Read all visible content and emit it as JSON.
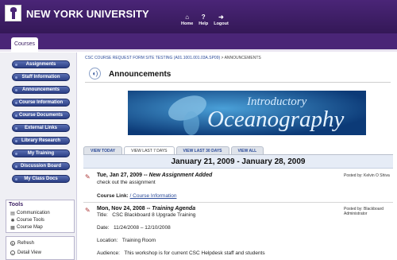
{
  "header": {
    "university": "NEW YORK UNIVERSITY",
    "links": [
      {
        "label": "Home",
        "icon": "home-icon"
      },
      {
        "label": "Help",
        "icon": "help-icon"
      },
      {
        "label": "Logout",
        "icon": "logout-icon"
      }
    ]
  },
  "tabs": {
    "courses": "Courses"
  },
  "sidebar": {
    "nav": [
      {
        "label": "Assignments"
      },
      {
        "label": "Staff Information"
      },
      {
        "label": "Announcements"
      },
      {
        "label": "Course Information"
      },
      {
        "label": "Course Documents"
      },
      {
        "label": "External Links"
      },
      {
        "label": "Library Research"
      },
      {
        "label": "My Training"
      },
      {
        "label": "Discussion Board"
      },
      {
        "label": "My Class Docs"
      }
    ],
    "tools": {
      "title": "Tools",
      "items": [
        {
          "label": "Communication"
        },
        {
          "label": "Course Tools"
        },
        {
          "label": "Course Map"
        }
      ]
    },
    "util": [
      {
        "label": "Refresh"
      },
      {
        "label": "Detail View"
      }
    ]
  },
  "main": {
    "breadcrumb": {
      "link": "CSC COURSE REQUEST FORM SITE TESTING (A01.1001.001.03A.SP09)",
      "separator": ">",
      "current": "ANNOUNCEMENTS"
    },
    "title": "Announcements",
    "banner": {
      "line1": "Introductory",
      "line2": "Oceanography"
    },
    "view_tabs": [
      {
        "label": "VIEW TODAY",
        "active": false
      },
      {
        "label": "VIEW LAST 7 DAYS",
        "active": true
      },
      {
        "label": "VIEW LAST 30 DAYS",
        "active": false
      },
      {
        "label": "VIEW ALL",
        "active": false
      }
    ],
    "date_range": "January 21, 2009 - January 28, 2009",
    "items": [
      {
        "date": "Tue, Jan 27, 2009 --",
        "title": "New Assignment Added",
        "posted_by": "Posted by: Kelvin O Shiva",
        "body": "check out the assignment",
        "course_link_label": "Course Link:",
        "course_link": "/ Course Information"
      },
      {
        "date": "Mon, Nov 24, 2008 --",
        "title": "Training Agenda",
        "posted_by": "Posted by: Blackboard",
        "posted_by_2": "Administrator",
        "title_label": "Title:",
        "title_value": "CSC Blackboard 8 Upgrade Training",
        "date_label": "Date:",
        "date_value": "11/24/2008 – 12/10/2008",
        "location_label": "Location:",
        "location_value": "Training Room",
        "audience_label": "Audience:",
        "audience_value": "This workshop is for current CSC Helpdesk staff and students"
      }
    ]
  }
}
